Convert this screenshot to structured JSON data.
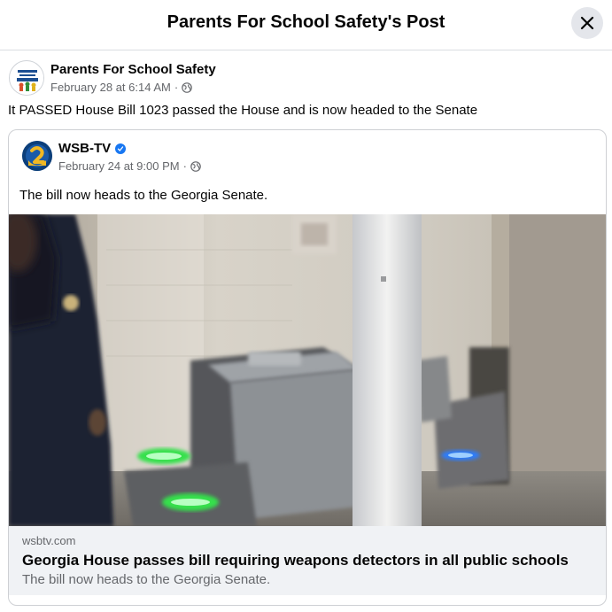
{
  "header": {
    "title": "Parents For School Safety's Post",
    "close_icon": "close-icon"
  },
  "post": {
    "author": "Parents For School Safety",
    "timestamp": "February 28 at 6:14 AM",
    "separator": "·",
    "audience_icon": "globe-icon",
    "text": "It PASSED House Bill 1023 passed the House and is now headed to the Senate"
  },
  "shared": {
    "author": "WSB-TV",
    "verified_icon": "verified-badge-icon",
    "timestamp": "February 24 at 9:00 PM",
    "separator": "·",
    "audience_icon": "globe-icon",
    "text": "The bill now heads to the Georgia Senate.",
    "link": {
      "domain": "wsbtv.com",
      "title": "Georgia House passes bill requiring weapons detectors in all public schools",
      "description": "The bill now heads to the Georgia Senate."
    }
  },
  "colors": {
    "primary_text": "#050505",
    "secondary_text": "#65676b",
    "verified_blue": "#1877f2",
    "preview_bg": "#f0f2f5",
    "close_bg": "#e4e6eb"
  }
}
